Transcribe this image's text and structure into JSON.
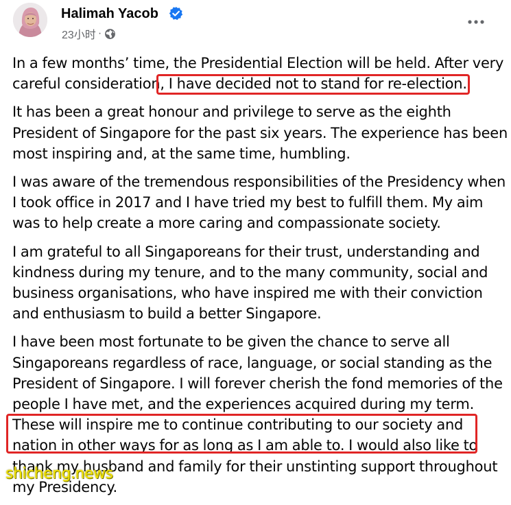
{
  "post": {
    "author": "Halimah Yacob",
    "verified": true,
    "timestamp": "23小时",
    "meta_separator": "·",
    "audience_icon": "globe-icon",
    "more_icon": "more-horizontal-icon",
    "paragraphs": [
      [
        "In a few months’ time, the Presidential Election will be held. After very",
        "careful consideration, I have decided not to stand for re-election."
      ],
      [
        "It has been a great honour and privilege to serve as the eighth",
        "President of Singapore for the past six years. The experience has been",
        "most inspiring and, at the same time, humbling."
      ],
      [
        "I was aware of the tremendous responsibilities of the Presidency when",
        "I took office in 2017 and I have tried my best to fulfill them. My aim",
        "was to help create a more caring and compassionate society."
      ],
      [
        "I am grateful to all Singaporeans for their trust, understanding and",
        "kindness during my tenure, and to the many community, social and",
        "business organisations, who have inspired me with their conviction",
        "and enthusiasm to build a better Singapore."
      ],
      [
        "I have been most fortunate to be given the chance to serve all",
        "Singaporeans regardless of race, language, or social standing as the",
        "President of Singapore. I will forever cherish the fond memories of the",
        "people I have met, and the experiences acquired during my term.",
        "These will inspire me to continue contributing to our society and",
        "nation in other ways for as long as I am able to. I would also like to",
        "thank my husband and family for their unstinting support throughout",
        "my Presidency."
      ]
    ]
  },
  "watermark": "shicheng.news",
  "colors": {
    "text": "#050505",
    "meta": "#65676b",
    "verified": "#1877f2",
    "highlight": "#e02525",
    "watermark": "#f2e200"
  }
}
